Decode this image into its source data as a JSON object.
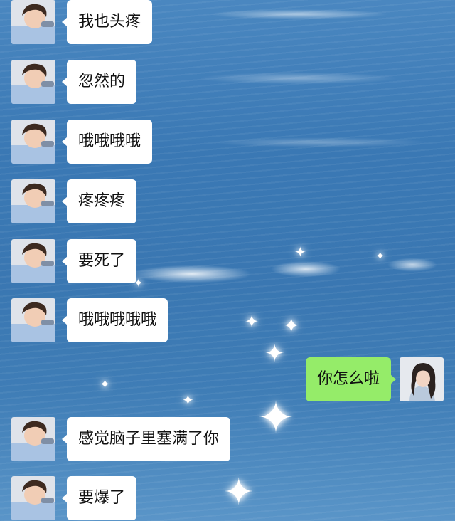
{
  "chat": {
    "messages": [
      {
        "sender": "contact",
        "text": "我也头疼"
      },
      {
        "sender": "contact",
        "text": "忽然的"
      },
      {
        "sender": "contact",
        "text": "哦哦哦哦"
      },
      {
        "sender": "contact",
        "text": "疼疼疼"
      },
      {
        "sender": "contact",
        "text": "要死了"
      },
      {
        "sender": "contact",
        "text": "哦哦哦哦哦"
      },
      {
        "sender": "me",
        "text": "你怎么啦"
      },
      {
        "sender": "contact",
        "text": "感觉脑子里塞满了你"
      },
      {
        "sender": "contact",
        "text": "要爆了"
      }
    ]
  },
  "colors": {
    "incoming_bubble": "#ffffff",
    "outgoing_bubble": "#95ec69",
    "text": "#111111",
    "background": "#3a78b4"
  },
  "icons": {
    "contact_avatar": "boy-avatar-icon",
    "my_avatar": "girl-avatar-icon",
    "decor": "sparkle-icon"
  }
}
